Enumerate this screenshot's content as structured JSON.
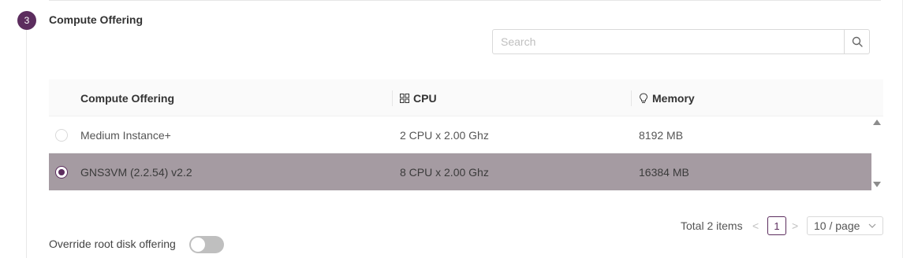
{
  "step": {
    "number": "3",
    "title": "Compute Offering"
  },
  "search": {
    "placeholder": "Search",
    "value": ""
  },
  "table": {
    "columns": [
      {
        "label": "Compute Offering",
        "icon": ""
      },
      {
        "label": "CPU",
        "icon": "appstore-icon"
      },
      {
        "label": "Memory",
        "icon": "bulb-icon"
      }
    ],
    "rows": [
      {
        "name": "Medium Instance+",
        "cpu": "2 CPU x 2.00 Ghz",
        "memory": "8192 MB",
        "selected": false
      },
      {
        "name": "GNS3VM (2.2.54) v2.2",
        "cpu": "8 CPU x 2.00 Ghz",
        "memory": "16384 MB",
        "selected": true
      }
    ]
  },
  "pagination": {
    "total_text": "Total 2 items",
    "prev": "<",
    "current_page": "1",
    "next": ">",
    "page_size": "10 / page"
  },
  "override": {
    "label": "Override root disk offering",
    "enabled": false
  },
  "colors": {
    "accent": "#5c2d5e",
    "selected_row": "#a59ba2"
  }
}
